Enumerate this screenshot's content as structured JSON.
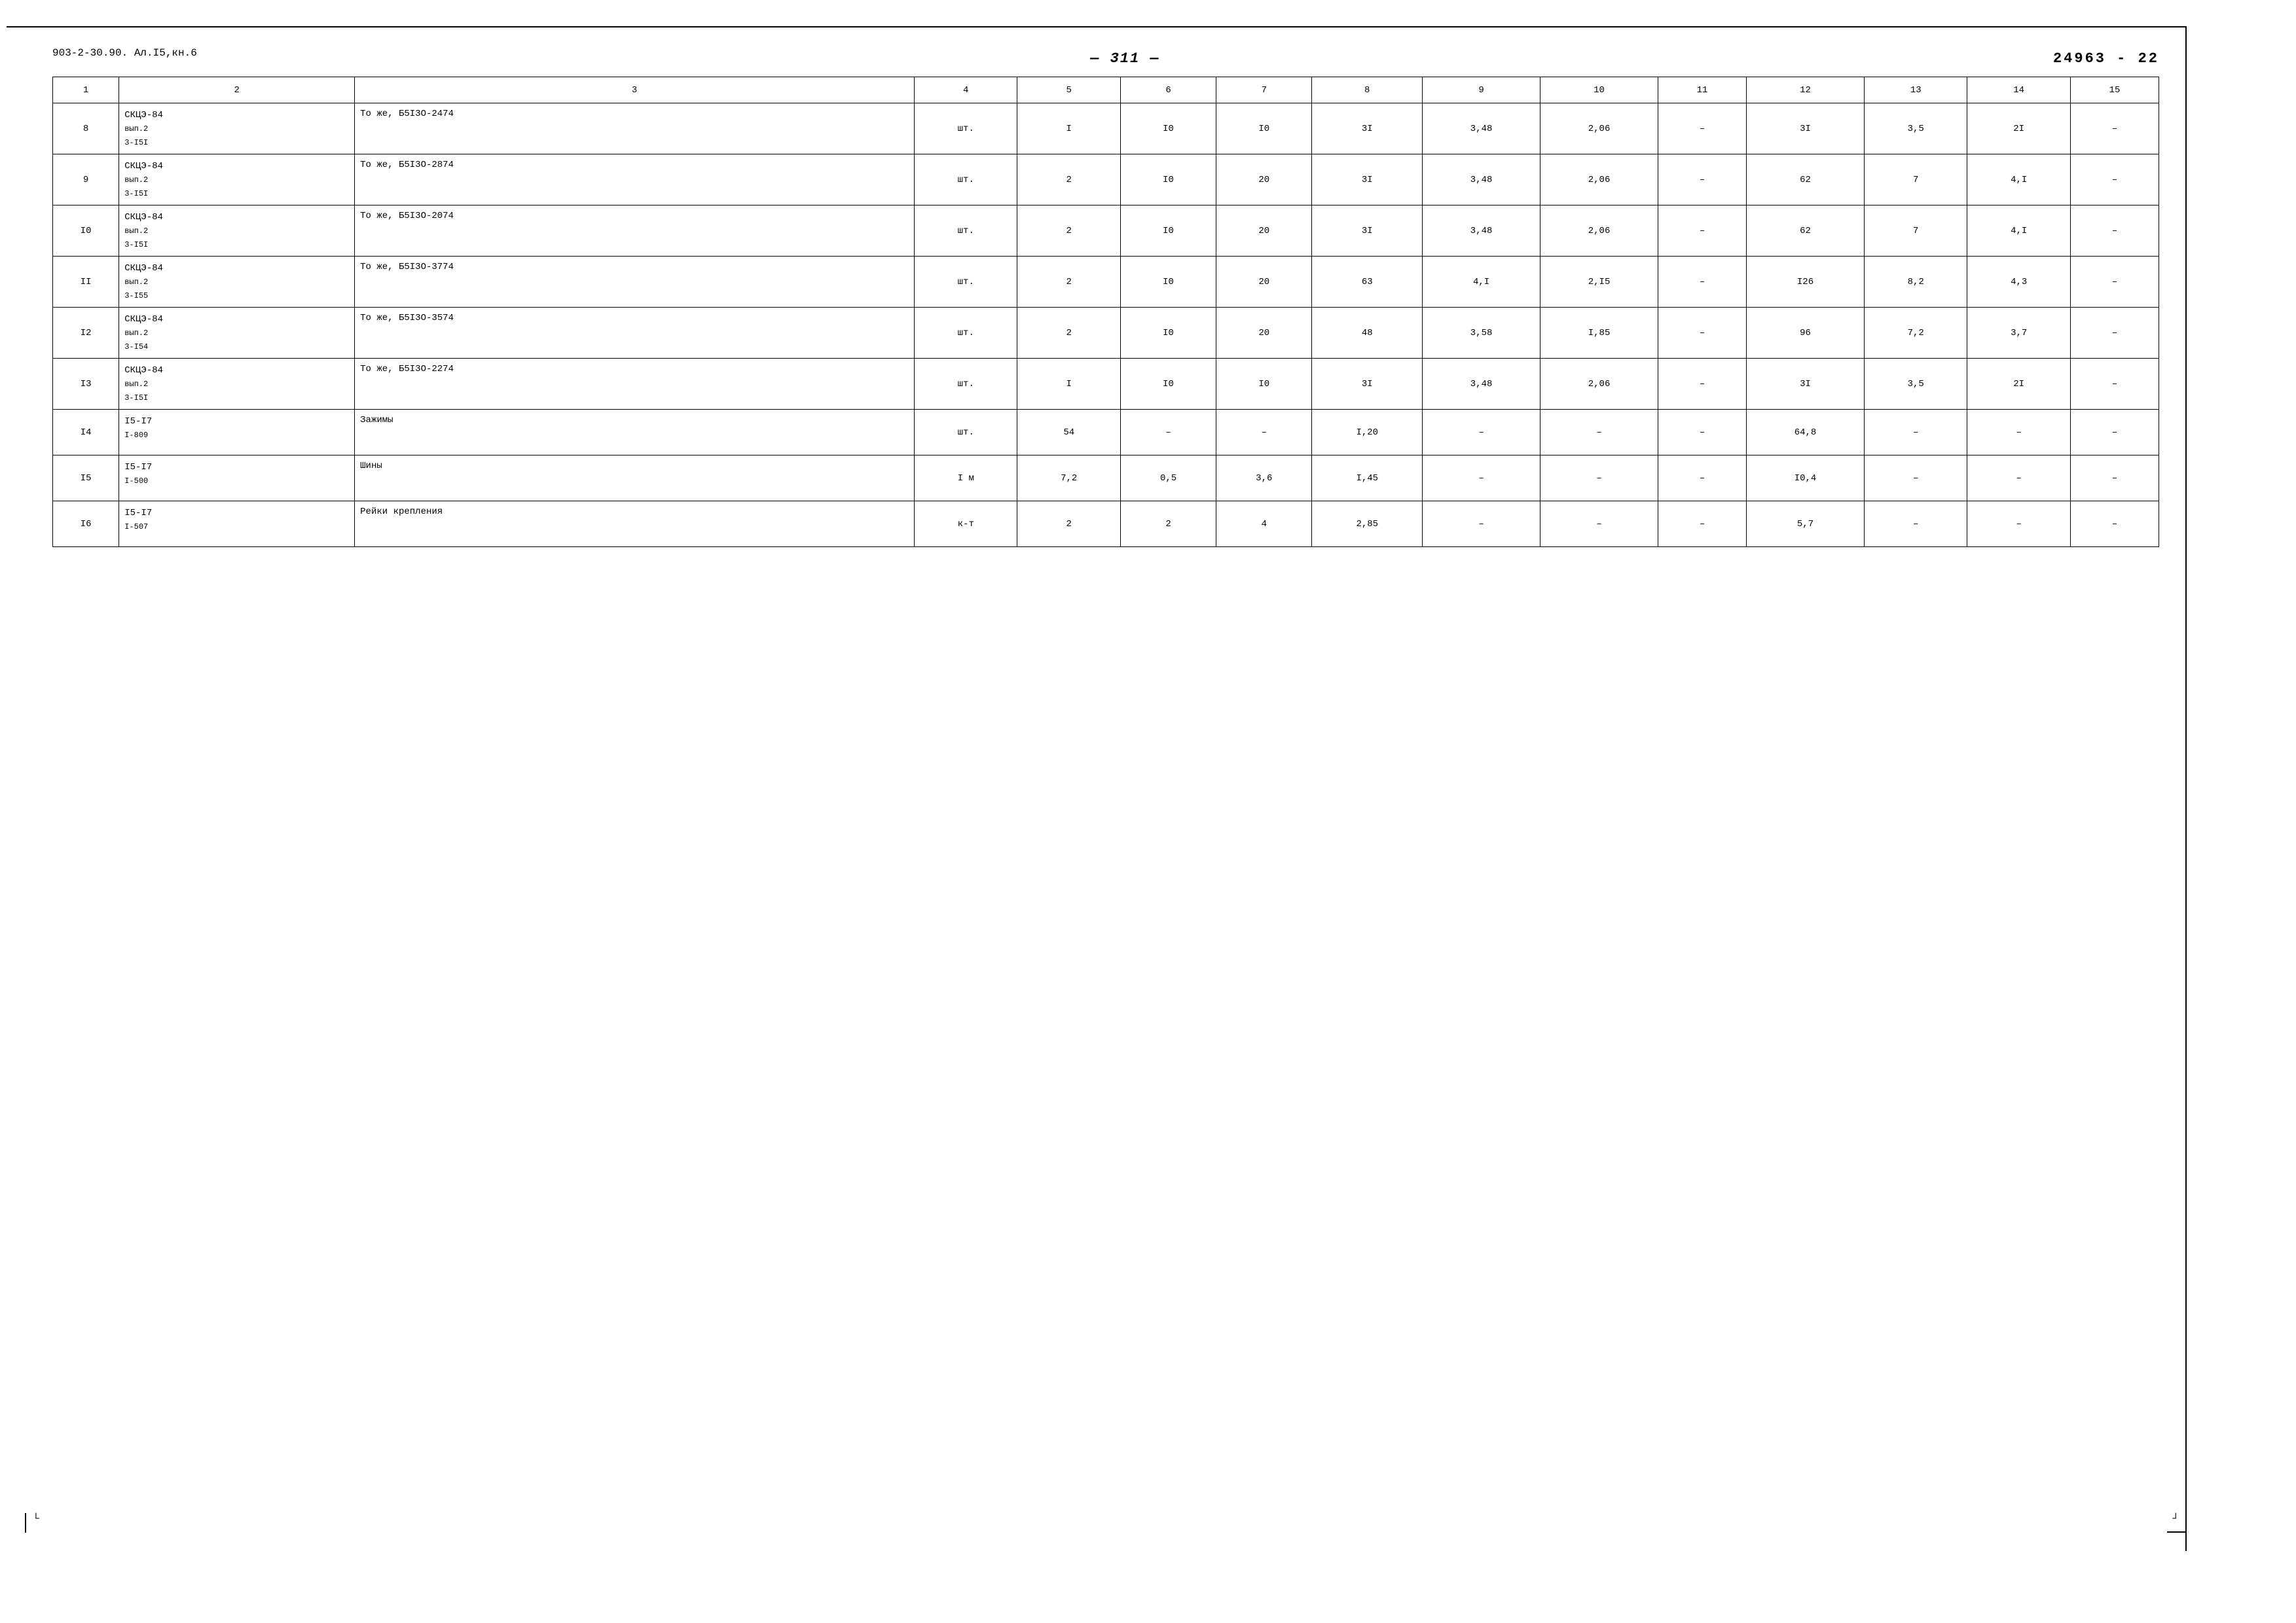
{
  "header": {
    "top_left": "903-2-30.90. Ал.I5,кн.6",
    "center": "— 311 —",
    "right": "24963 - 22"
  },
  "table": {
    "columns": [
      {
        "id": 1,
        "label": "1"
      },
      {
        "id": 2,
        "label": "2"
      },
      {
        "id": 3,
        "label": "3"
      },
      {
        "id": 4,
        "label": "4"
      },
      {
        "id": 5,
        "label": "5"
      },
      {
        "id": 6,
        "label": "6"
      },
      {
        "id": 7,
        "label": "7"
      },
      {
        "id": 8,
        "label": "8"
      },
      {
        "id": 9,
        "label": "9"
      },
      {
        "id": 10,
        "label": "10"
      },
      {
        "id": 11,
        "label": "11"
      },
      {
        "id": 12,
        "label": "12"
      },
      {
        "id": 13,
        "label": "13"
      },
      {
        "id": 14,
        "label": "14"
      },
      {
        "id": 15,
        "label": "15"
      }
    ],
    "rows": [
      {
        "col1": "8",
        "col2_line1": "СКЦЭ-84",
        "col2_line2": "вып.2",
        "col2_line3": "3-I5I",
        "col3": "То же, Б5I3О-2474",
        "col4": "шт.",
        "col5": "I",
        "col6": "I0",
        "col7": "I0",
        "col8": "3I",
        "col9": "3,48",
        "col10": "2,06",
        "col11": "–",
        "col12": "3I",
        "col13": "3,5",
        "col14": "2I",
        "col15": "–"
      },
      {
        "col1": "9",
        "col2_line1": "СКЦЭ-84",
        "col2_line2": "вып.2",
        "col2_line3": "3-I5I",
        "col3": "То же, Б5I3О-2874",
        "col4": "шт.",
        "col5": "2",
        "col6": "I0",
        "col7": "20",
        "col8": "3I",
        "col9": "3,48",
        "col10": "2,06",
        "col11": "–",
        "col12": "62",
        "col13": "7",
        "col14": "4,I",
        "col15": "–"
      },
      {
        "col1": "I0",
        "col2_line1": "СКЦЭ-84",
        "col2_line2": "вып.2",
        "col2_line3": "3-I5I",
        "col3": "То же, Б5I3О-2074",
        "col4": "шт.",
        "col5": "2",
        "col6": "I0",
        "col7": "20",
        "col8": "3I",
        "col9": "3,48",
        "col10": "2,06",
        "col11": "–",
        "col12": "62",
        "col13": "7",
        "col14": "4,I",
        "col15": "–"
      },
      {
        "col1": "II",
        "col2_line1": "СКЦЭ-84",
        "col2_line2": "вып.2",
        "col2_line3": "3-I55",
        "col3": "То же, Б5I3О-3774",
        "col4": "шт.",
        "col5": "2",
        "col6": "I0",
        "col7": "20",
        "col8": "63",
        "col9": "4,I",
        "col10": "2,I5",
        "col11": "–",
        "col12": "I26",
        "col13": "8,2",
        "col14": "4,3",
        "col15": "–"
      },
      {
        "col1": "I2",
        "col2_line1": "СКЦЭ-84",
        "col2_line2": "вып.2",
        "col2_line3": "3-I54",
        "col3": "То же, Б5I3О-3574",
        "col4": "шт.",
        "col5": "2",
        "col6": "I0",
        "col7": "20",
        "col8": "48",
        "col9": "3,58",
        "col10": "I,85",
        "col11": "–",
        "col12": "96",
        "col13": "7,2",
        "col14": "3,7",
        "col15": "–"
      },
      {
        "col1": "I3",
        "col2_line1": "СКЦЭ-84",
        "col2_line2": "вып.2",
        "col2_line3": "3-I5I",
        "col3": "То же, Б5I3О-2274",
        "col4": "шт.",
        "col5": "I",
        "col6": "I0",
        "col7": "I0",
        "col8": "3I",
        "col9": "3,48",
        "col10": "2,06",
        "col11": "–",
        "col12": "3I",
        "col13": "3,5",
        "col14": "2I",
        "col15": "–"
      },
      {
        "col1": "I4",
        "col2_line1": "I5-I7",
        "col2_line2": "I-809",
        "col2_line3": "",
        "col3": "Зажимы",
        "col4": "шт.",
        "col5": "54",
        "col6": "–",
        "col7": "–",
        "col8": "I,20",
        "col9": "–",
        "col10": "–",
        "col11": "–",
        "col12": "64,8",
        "col13": "–",
        "col14": "–",
        "col15": "–"
      },
      {
        "col1": "I5",
        "col2_line1": "I5-I7",
        "col2_line2": "I-500",
        "col2_line3": "",
        "col3": "Шины",
        "col4": "I м",
        "col5": "7,2",
        "col6": "0,5",
        "col7": "3,6",
        "col8": "I,45",
        "col9": "–",
        "col10": "–",
        "col11": "–",
        "col12": "I0,4",
        "col13": "–",
        "col14": "–",
        "col15": "–"
      },
      {
        "col1": "I6",
        "col2_line1": "I5-I7",
        "col2_line2": "I-507",
        "col2_line3": "",
        "col3": "Рейки крепления",
        "col4": "к-т",
        "col5": "2",
        "col6": "2",
        "col7": "4",
        "col8": "2,85",
        "col9": "–",
        "col10": "–",
        "col11": "–",
        "col12": "5,7",
        "col13": "–",
        "col14": "–",
        "col15": "–"
      }
    ]
  },
  "corner_marks": {
    "bottom_left": "└",
    "bottom_right": "┘"
  }
}
